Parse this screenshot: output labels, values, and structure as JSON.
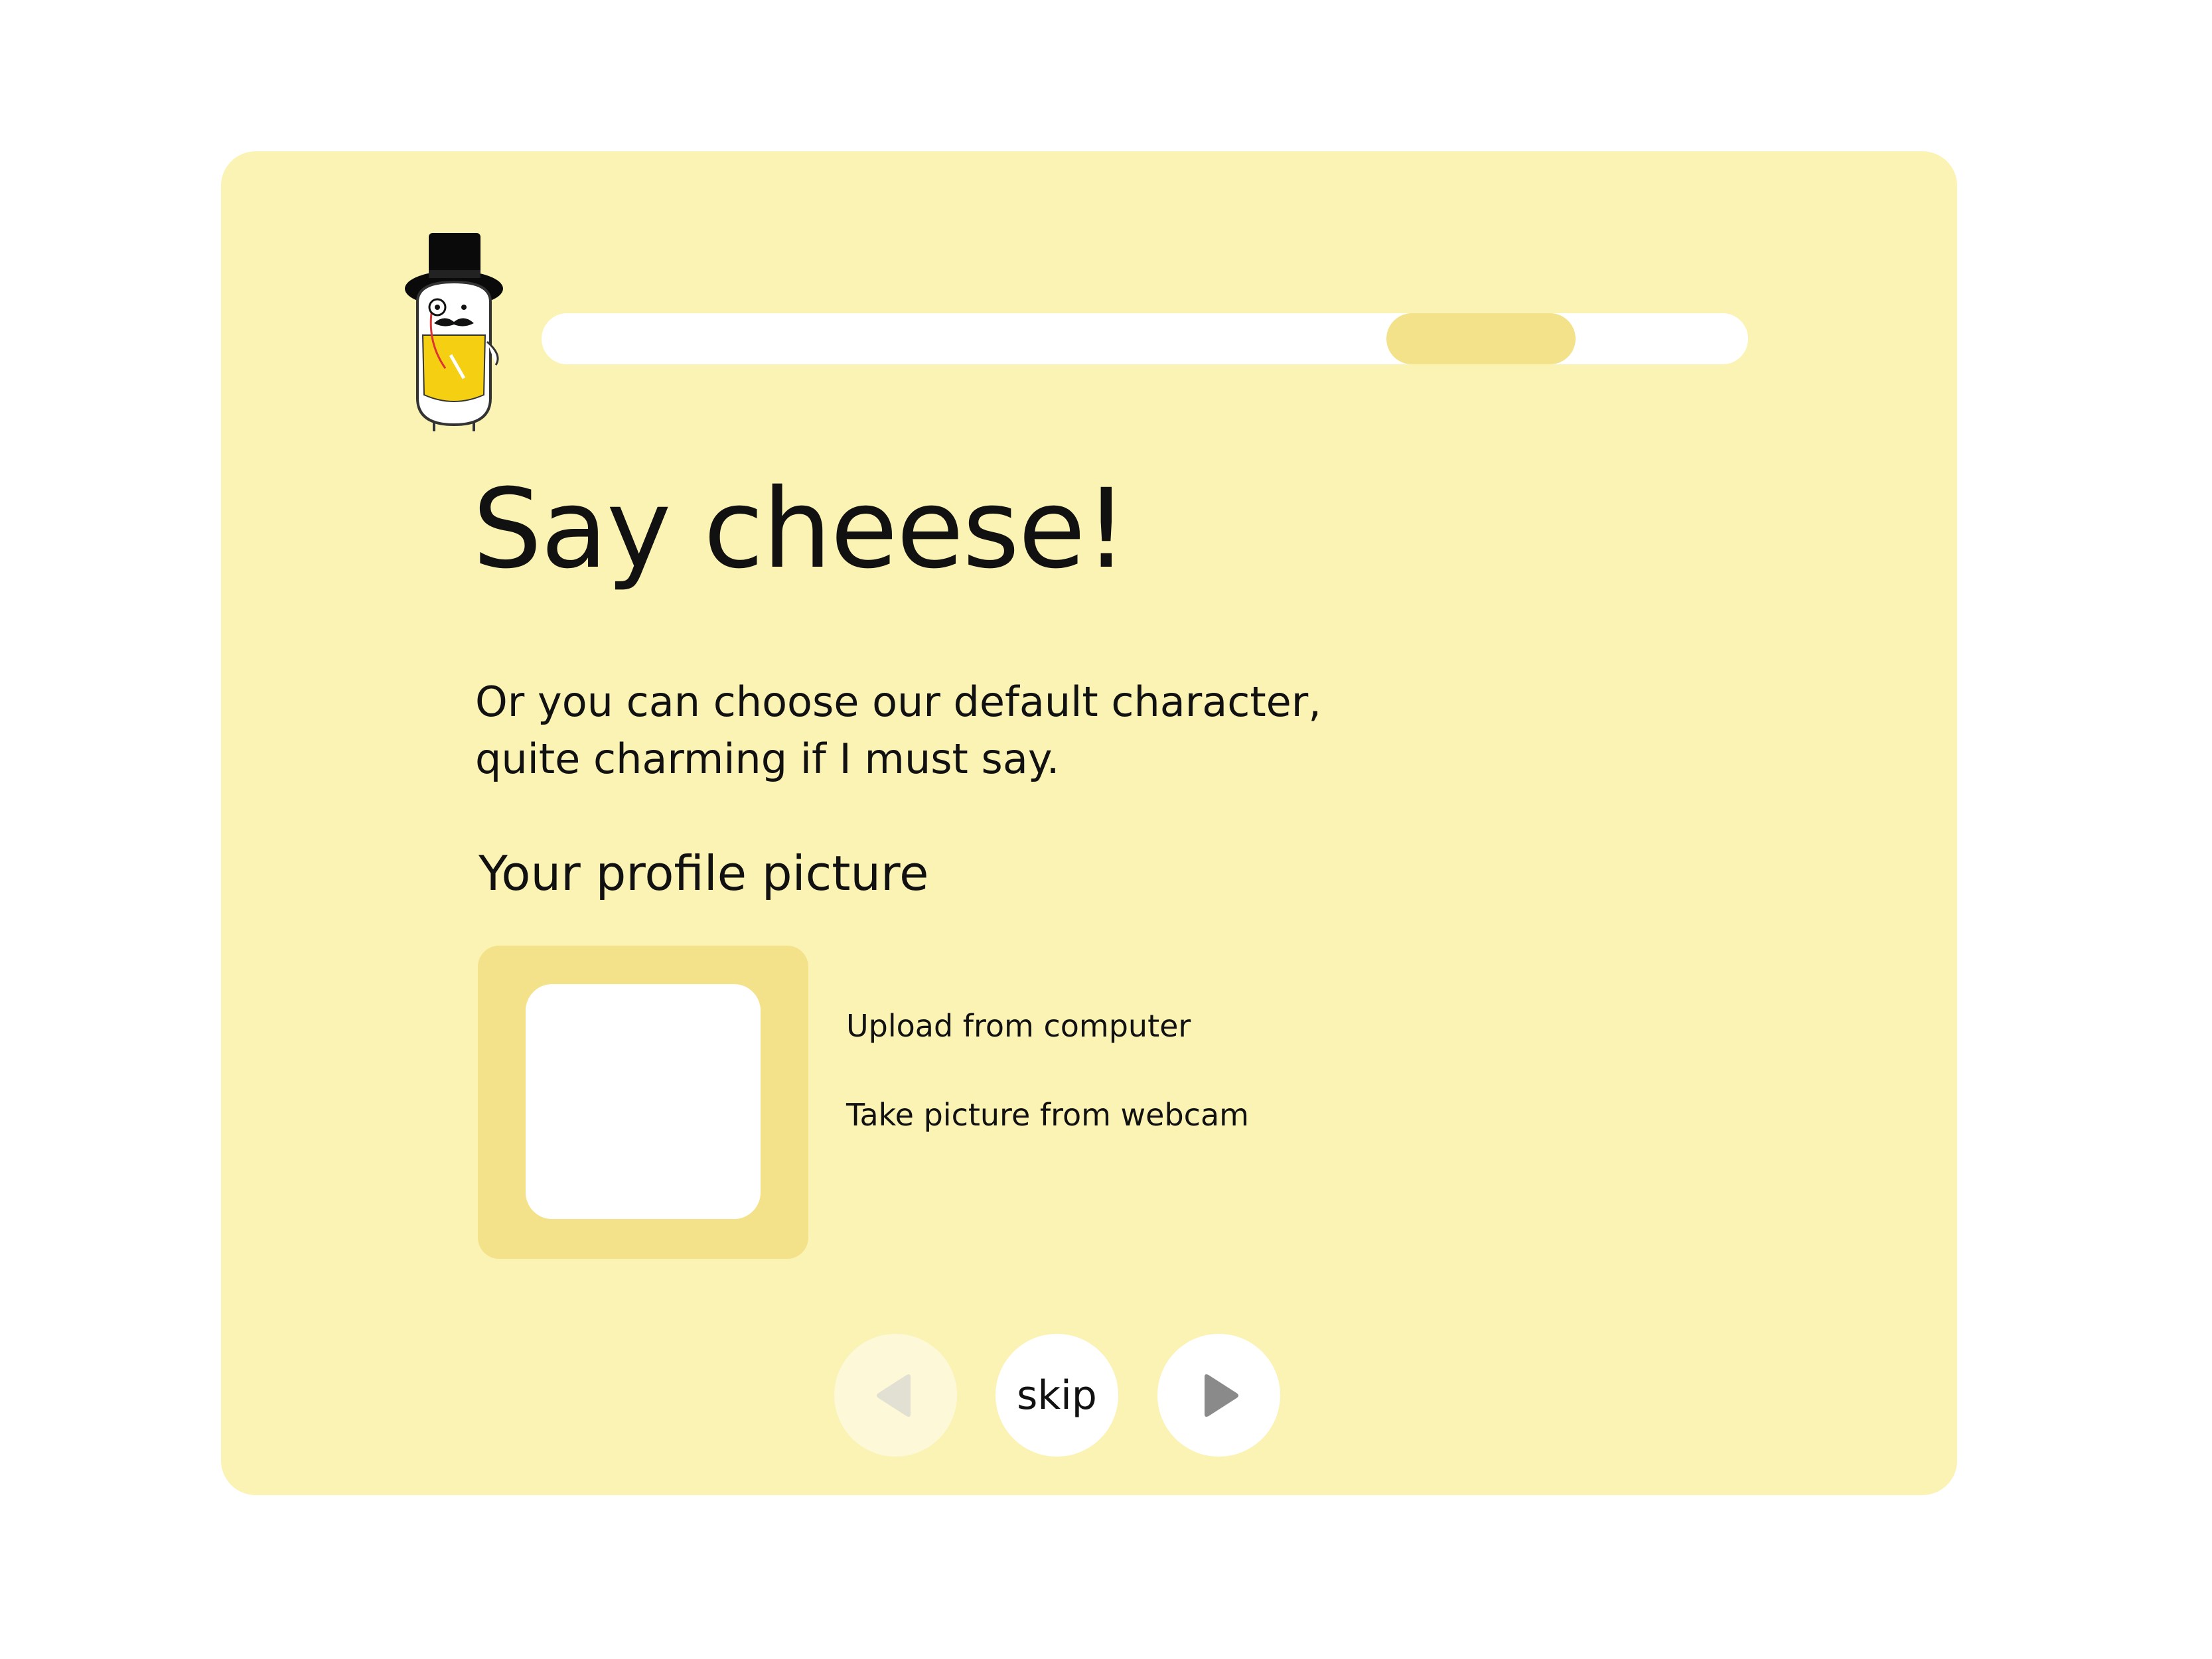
{
  "progress": {
    "value": 0.7
  },
  "header": {
    "mascot_icon": "gentleman-mascot-icon"
  },
  "main": {
    "title": "Say cheese!",
    "subtitle_line1": "Or you can choose our default character,",
    "subtitle_line2": "quite charming if I must say.",
    "section_label": "Your profile picture",
    "options": {
      "upload": "Upload from computer",
      "webcam": "Take picture from webcam"
    }
  },
  "nav": {
    "prev_icon": "back-arrow-icon",
    "skip_label": "skip",
    "next_icon": "next-arrow-icon"
  },
  "colors": {
    "card_bg": "#fbf3b4",
    "accent": "#f3e28a",
    "white": "#ffffff",
    "text": "#111111",
    "arrow_active": "#8a8a8a",
    "arrow_disabled": "#e2e0d2"
  }
}
